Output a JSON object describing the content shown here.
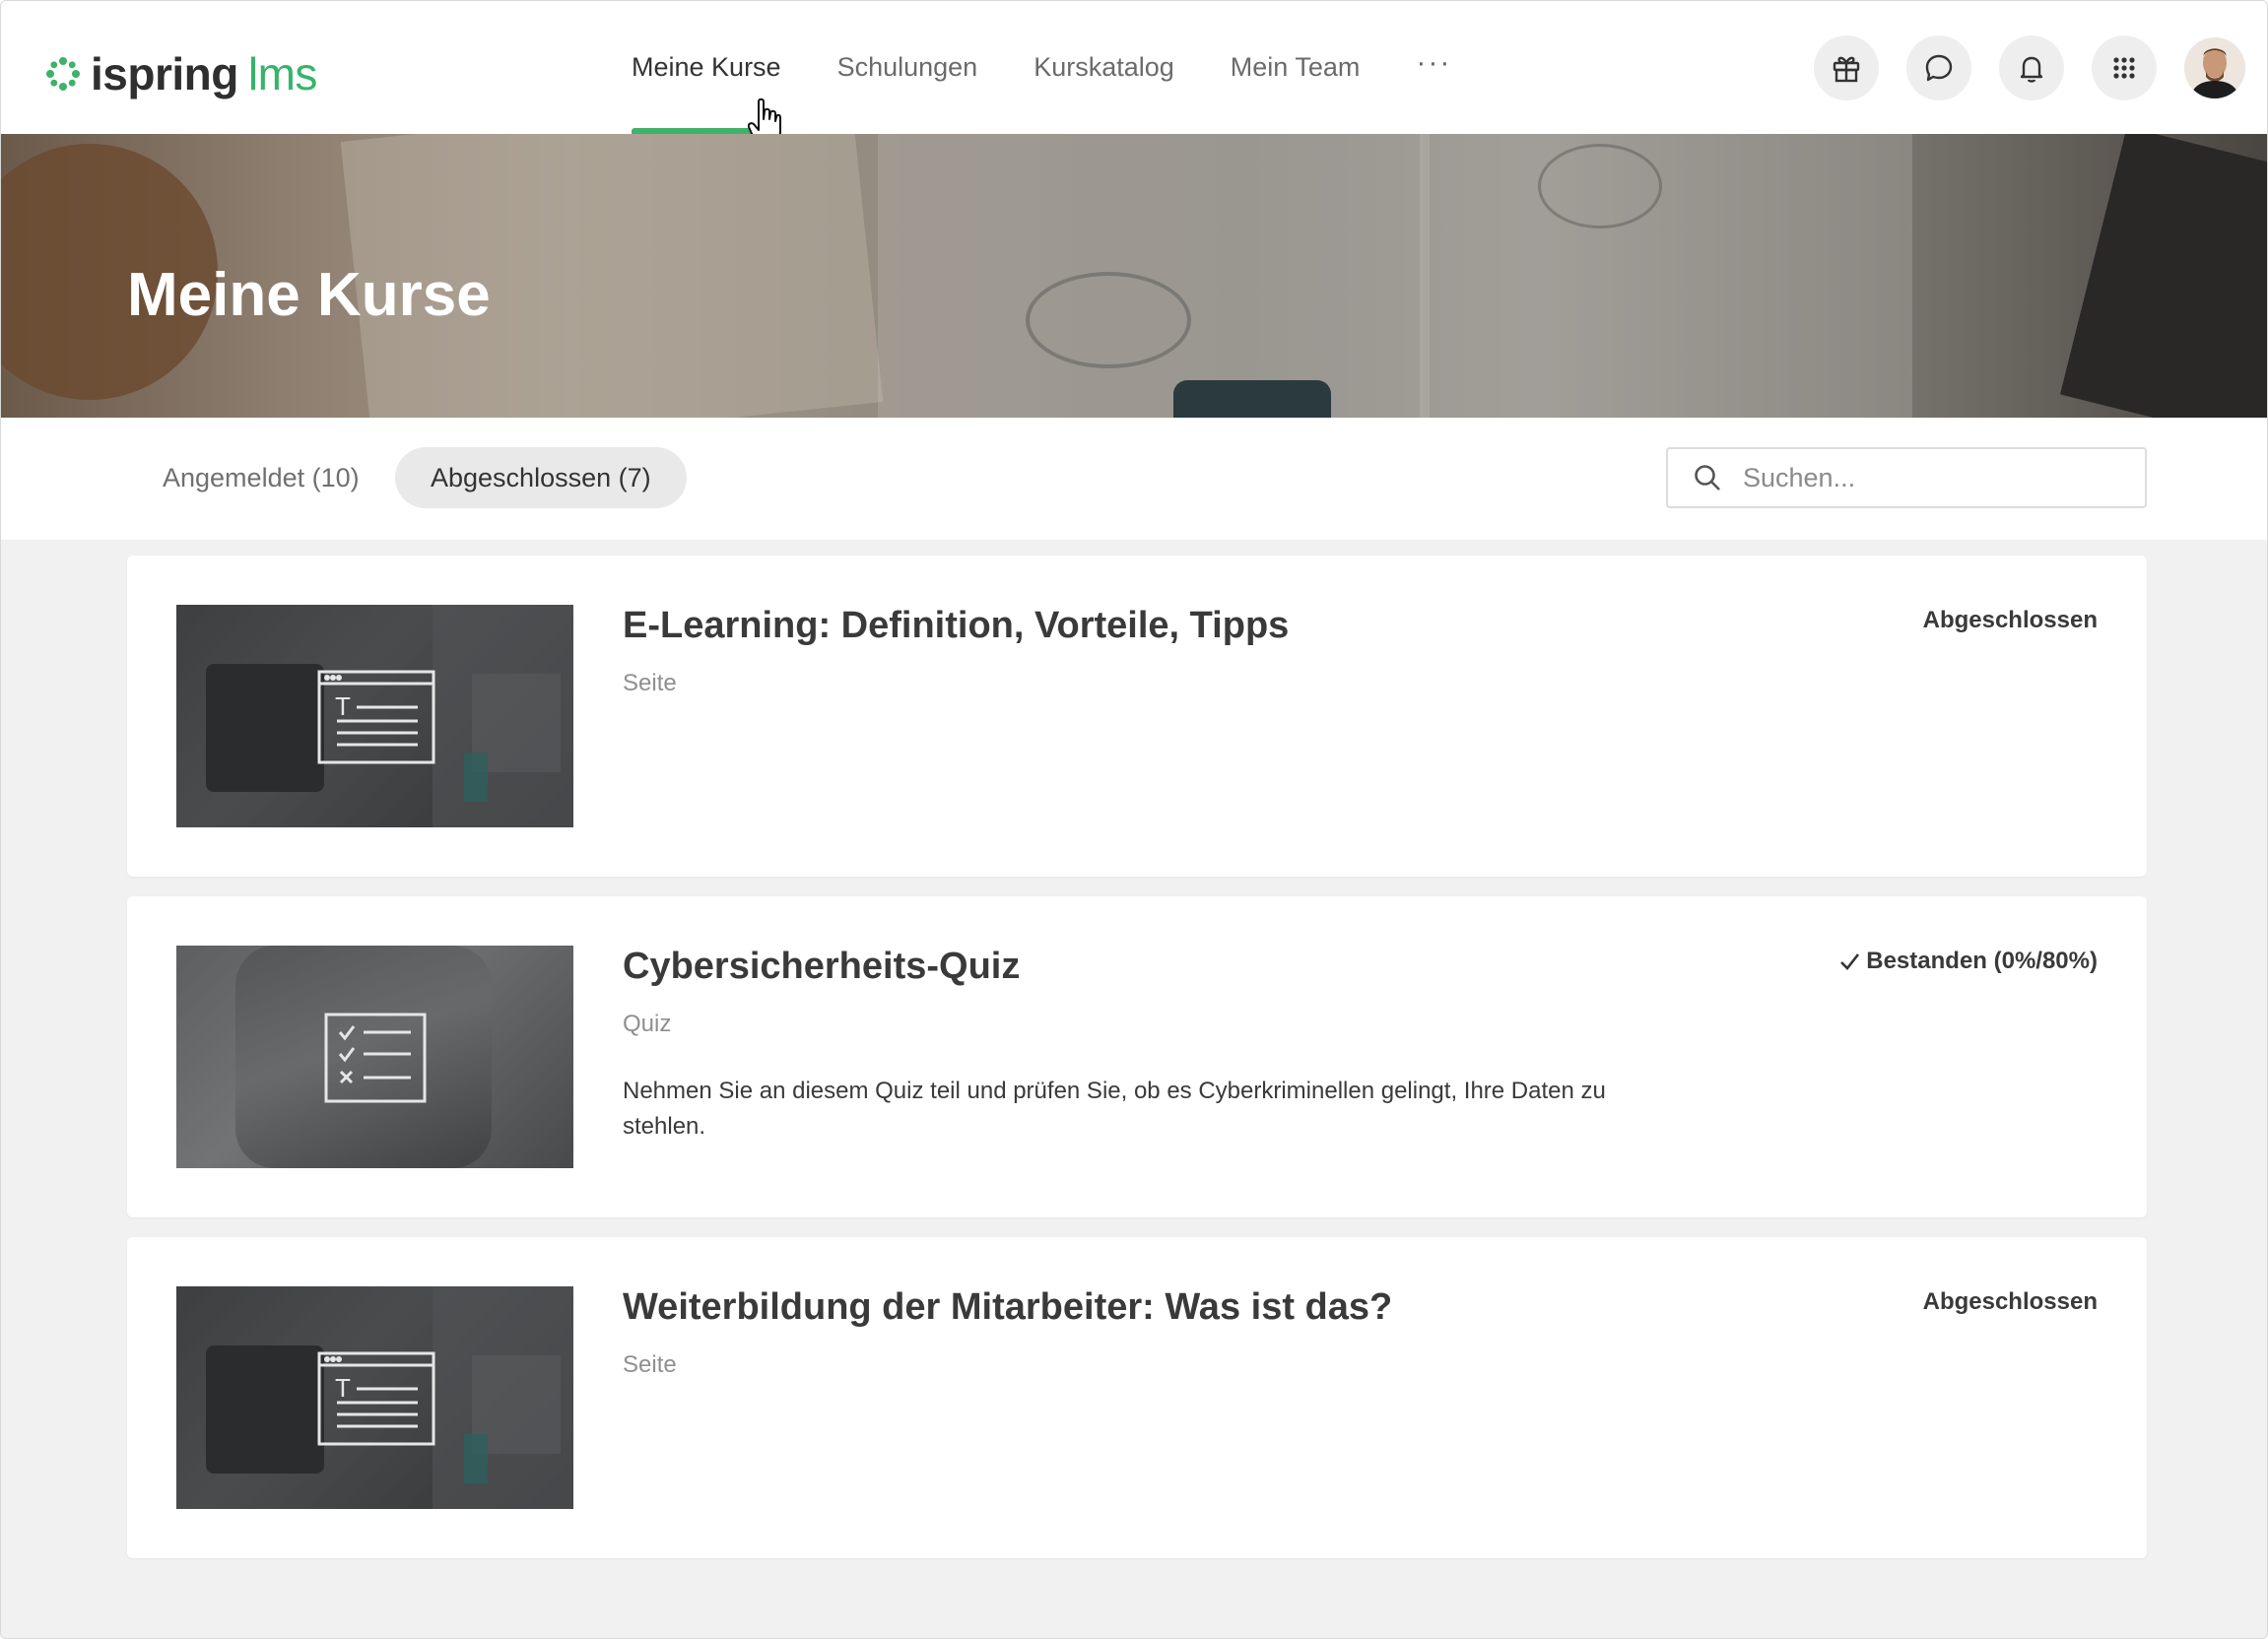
{
  "brand": {
    "name": "ispring",
    "product": "lms",
    "accent": "#3eb16a"
  },
  "nav": {
    "items": [
      {
        "label": "Meine Kurse",
        "active": true
      },
      {
        "label": "Schulungen",
        "active": false
      },
      {
        "label": "Kurskatalog",
        "active": false
      },
      {
        "label": "Mein Team",
        "active": false
      }
    ],
    "more_label": "···"
  },
  "header_icons": [
    "gift-icon",
    "chat-icon",
    "bell-icon",
    "apps-grid-icon",
    "avatar"
  ],
  "hero": {
    "title": "Meine Kurse"
  },
  "tabs": [
    {
      "label": "Angemeldet (10)",
      "selected": false
    },
    {
      "label": "Abgeschlossen (7)",
      "selected": true
    }
  ],
  "search": {
    "placeholder": "Suchen..."
  },
  "courses": [
    {
      "title": "E-Learning: Definition, Vorteile, Tipps",
      "type": "Seite",
      "description": "",
      "status": "Abgeschlossen",
      "status_check": false,
      "thumbnail_icon": "page-document-icon"
    },
    {
      "title": "Cybersicherheits-Quiz",
      "type": "Quiz",
      "description": "Nehmen Sie an diesem Quiz teil und prüfen Sie, ob es Cyberkriminellen gelingt, Ihre Daten zu stehlen.",
      "status": "Bestanden (0%/80%)",
      "status_check": true,
      "thumbnail_icon": "quiz-checklist-icon"
    },
    {
      "title": "Weiterbildung der Mitarbeiter: Was ist das?",
      "type": "Seite",
      "description": "",
      "status": "Abgeschlossen",
      "status_check": false,
      "thumbnail_icon": "page-document-icon"
    }
  ]
}
